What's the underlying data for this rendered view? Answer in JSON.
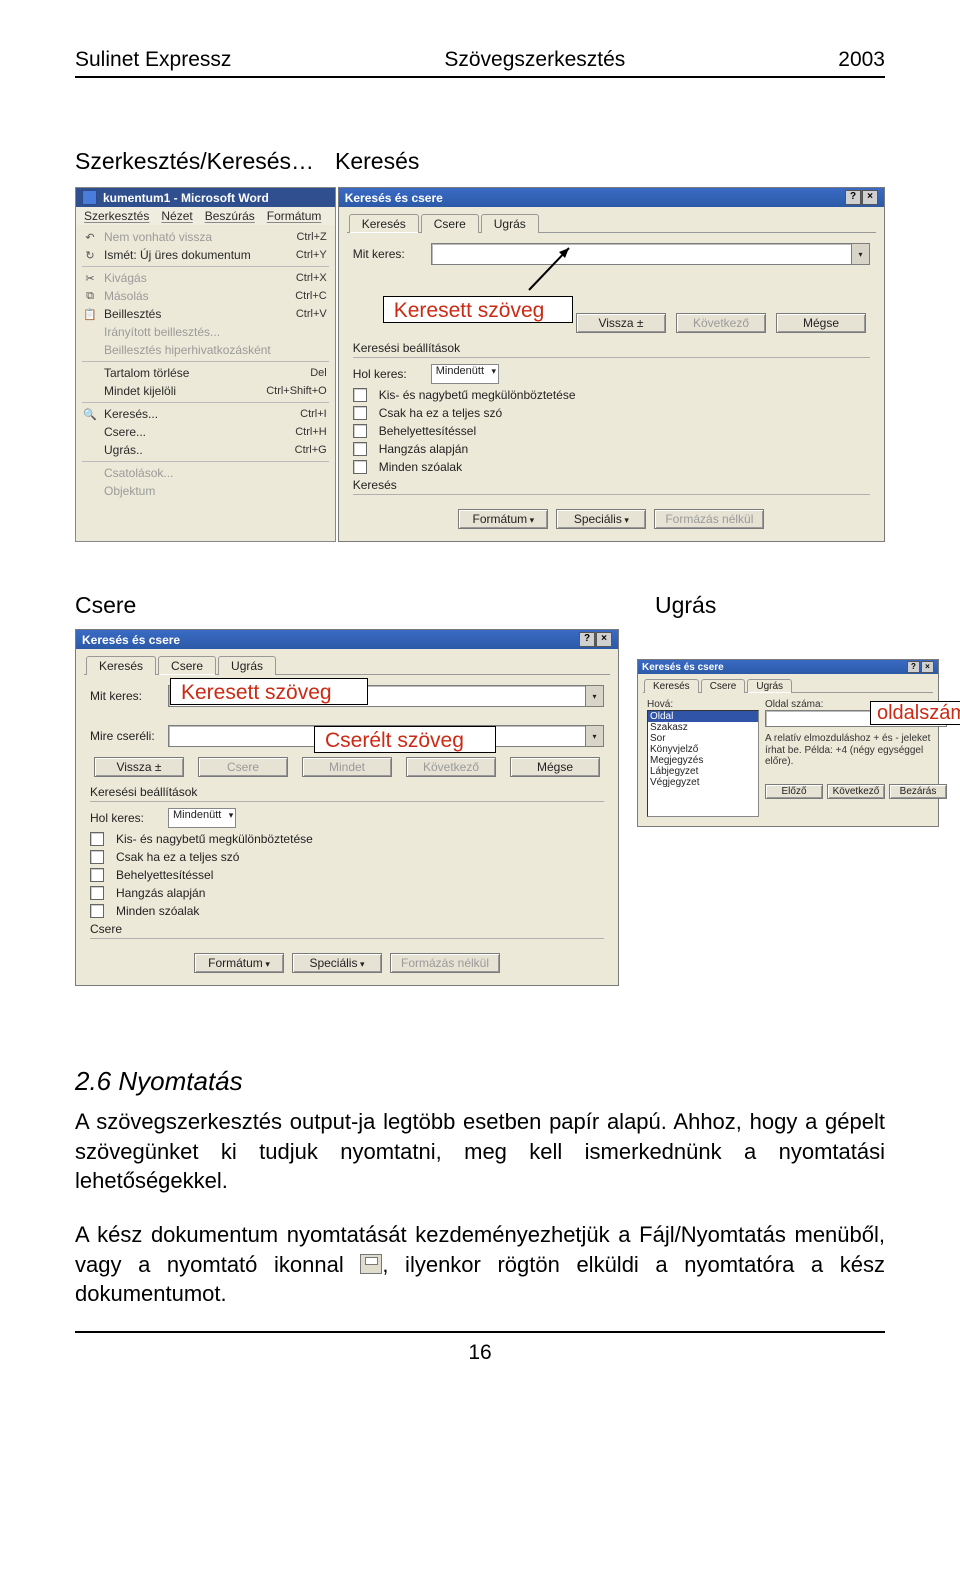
{
  "header": {
    "left": "Sulinet Expressz",
    "center": "Szövegszerkesztés",
    "right": "2003"
  },
  "subheads": {
    "left": "Szerkesztés/Keresés…",
    "right": "Keresés"
  },
  "editMenu": {
    "titlebar": "kumentum1 - Microsoft Word",
    "menubar": [
      "Szerkesztés",
      "Nézet",
      "Beszúrás",
      "Formátum"
    ],
    "items": [
      {
        "icon": "↶",
        "label": "Nem vonható vissza",
        "shortcut": "Ctrl+Z",
        "dim": true
      },
      {
        "icon": "↻",
        "label": "Ismét: Új üres dokumentum",
        "shortcut": "Ctrl+Y"
      },
      "sep",
      {
        "icon": "✂",
        "label": "Kivágás",
        "shortcut": "Ctrl+X",
        "dim": true
      },
      {
        "icon": "⧉",
        "label": "Másolás",
        "shortcut": "Ctrl+C",
        "dim": true
      },
      {
        "icon": "📋",
        "label": "Beillesztés",
        "shortcut": "Ctrl+V"
      },
      {
        "icon": "",
        "label": "Irányított beillesztés...",
        "shortcut": "",
        "dim": true
      },
      {
        "icon": "",
        "label": "Beillesztés hiperhivatkozásként",
        "shortcut": "",
        "dim": true
      },
      "sep",
      {
        "icon": "",
        "label": "Tartalom törlése",
        "shortcut": "Del"
      },
      {
        "icon": "",
        "label": "Mindet kijelöli",
        "shortcut": "Ctrl+Shift+O"
      },
      "sep",
      {
        "icon": "🔍",
        "label": "Keresés...",
        "shortcut": "Ctrl+I"
      },
      {
        "icon": "",
        "label": "Csere...",
        "shortcut": "Ctrl+H"
      },
      {
        "icon": "",
        "label": "Ugrás..",
        "shortcut": "Ctrl+G"
      },
      "sep",
      {
        "icon": "",
        "label": "Csatolások...",
        "shortcut": "",
        "dim": true
      },
      {
        "icon": "",
        "label": "Objektum",
        "shortcut": "",
        "dim": true
      }
    ]
  },
  "dlgKereses": {
    "title": "Keresés és csere",
    "tabs": [
      "Keresés",
      "Csere",
      "Ugrás"
    ],
    "activeTab": 0,
    "lblMitKeres": "Mit keres:",
    "btnVissza": "Vissza  ±",
    "btnKovetkezo": "Következő",
    "btnMegse": "Mégse",
    "grpKeresesi": "Keresési beállítások",
    "lblHolKeres": "Hol keres:",
    "ddMindenutt": "Mindenütt",
    "chk1": "Kis- és nagybetű megkülönböztetése",
    "chk2": "Csak ha ez a teljes szó",
    "chk3": "Behelyettesítéssel",
    "chk4": "Hangzás alapján",
    "chk5": "Minden szóalak",
    "grpKereses": "Keresés",
    "btnFormatum": "Formátum",
    "btnSpecialis": "Speciális",
    "btnFormazasNelkul": "Formázás nélkül"
  },
  "overlayKeresett": "Keresett szöveg",
  "row2": {
    "csere": "Csere",
    "ugras": "Ugrás"
  },
  "dlgCsere": {
    "title": "Keresés és csere",
    "tabs": [
      "Keresés",
      "Csere",
      "Ugrás"
    ],
    "activeTab": 1,
    "lblMitKeres": "Mit keres:",
    "lblMireCsereli": "Mire cseréli:",
    "btnVissza": "Vissza  ±",
    "btnCsere": "Csere",
    "btnMindet": "Mindet",
    "btnKovetkezo": "Következő",
    "btnMegse": "Mégse",
    "grpKeresesi": "Keresési beállítások",
    "lblHolKeres": "Hol keres:",
    "ddMindenutt": "Mindenütt",
    "chk1": "Kis- és nagybetű megkülönböztetése",
    "chk2": "Csak ha ez a teljes szó",
    "chk3": "Behelyettesítéssel",
    "chk4": "Hangzás alapján",
    "chk5": "Minden szóalak",
    "grpCsere": "Csere",
    "btnFormatum": "Formátum",
    "btnSpecialis": "Speciális",
    "btnFormazasNelkul": "Formázás nélkül"
  },
  "overlayKeresett2": "Keresett szöveg",
  "overlayCserelt": "Cserélt szöveg",
  "dlgUgras": {
    "title": "Keresés és csere",
    "tabs": [
      "Keresés",
      "Csere",
      "Ugrás"
    ],
    "activeTab": 2,
    "lblHova": "Hová:",
    "listItems": [
      "Oldal",
      "Szakasz",
      "Sor",
      "Könyvjelző",
      "Megjegyzés",
      "Lábjegyzet",
      "Végjegyzet"
    ],
    "listSelected": 0,
    "lblOldalSzama": "Oldal száma:",
    "note": "A relatív elmozduláshoz + és - jeleket írhat be. Példa: +4 (négy egységgel előre).",
    "btnElozo": "Előző",
    "btnKovetkezo": "Következő",
    "btnBezaras": "Bezárás"
  },
  "overlayOldal": "oldalszám",
  "section": {
    "heading": "2.6 Nyomtatás",
    "p1": "A szövegszerkesztés output-ja legtöbb esetben papír alapú. Ahhoz, hogy a gépelt szövegünket ki tudjuk nyomtatni, meg kell ismerkednünk a nyomtatási lehetőségekkel.",
    "p2a": "A kész dokumentum nyomtatását kezdeményezhetjük a Fájl/Nyomtatás menüből, vagy a nyomtató ikonnal",
    "p2b": ", ilyenkor rögtön elküldi a nyomtatóra a kész dokumentumot."
  },
  "pageNumber": "16"
}
